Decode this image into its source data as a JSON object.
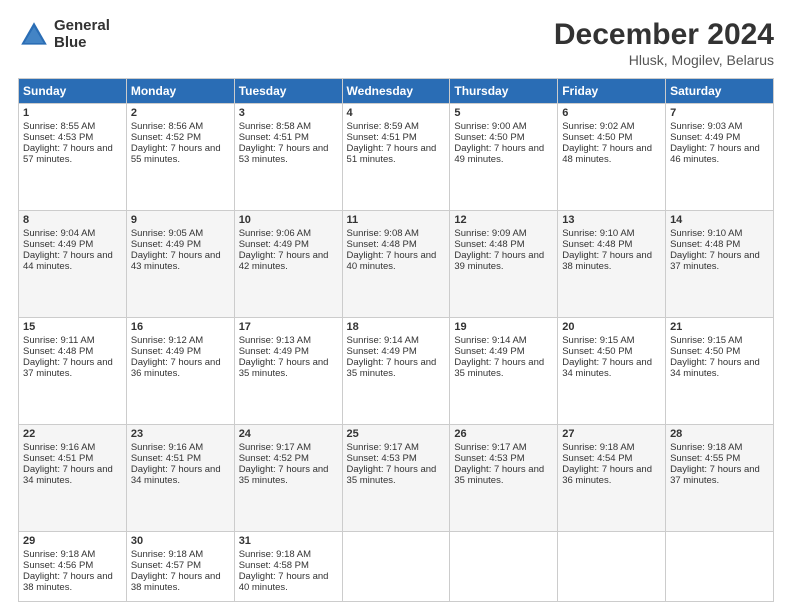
{
  "header": {
    "logo_line1": "General",
    "logo_line2": "Blue",
    "title": "December 2024",
    "subtitle": "Hlusk, Mogilev, Belarus"
  },
  "columns": [
    "Sunday",
    "Monday",
    "Tuesday",
    "Wednesday",
    "Thursday",
    "Friday",
    "Saturday"
  ],
  "weeks": [
    [
      {
        "day": "1",
        "sunrise": "Sunrise: 8:55 AM",
        "sunset": "Sunset: 4:53 PM",
        "daylight": "Daylight: 7 hours and 57 minutes."
      },
      {
        "day": "2",
        "sunrise": "Sunrise: 8:56 AM",
        "sunset": "Sunset: 4:52 PM",
        "daylight": "Daylight: 7 hours and 55 minutes."
      },
      {
        "day": "3",
        "sunrise": "Sunrise: 8:58 AM",
        "sunset": "Sunset: 4:51 PM",
        "daylight": "Daylight: 7 hours and 53 minutes."
      },
      {
        "day": "4",
        "sunrise": "Sunrise: 8:59 AM",
        "sunset": "Sunset: 4:51 PM",
        "daylight": "Daylight: 7 hours and 51 minutes."
      },
      {
        "day": "5",
        "sunrise": "Sunrise: 9:00 AM",
        "sunset": "Sunset: 4:50 PM",
        "daylight": "Daylight: 7 hours and 49 minutes."
      },
      {
        "day": "6",
        "sunrise": "Sunrise: 9:02 AM",
        "sunset": "Sunset: 4:50 PM",
        "daylight": "Daylight: 7 hours and 48 minutes."
      },
      {
        "day": "7",
        "sunrise": "Sunrise: 9:03 AM",
        "sunset": "Sunset: 4:49 PM",
        "daylight": "Daylight: 7 hours and 46 minutes."
      }
    ],
    [
      {
        "day": "8",
        "sunrise": "Sunrise: 9:04 AM",
        "sunset": "Sunset: 4:49 PM",
        "daylight": "Daylight: 7 hours and 44 minutes."
      },
      {
        "day": "9",
        "sunrise": "Sunrise: 9:05 AM",
        "sunset": "Sunset: 4:49 PM",
        "daylight": "Daylight: 7 hours and 43 minutes."
      },
      {
        "day": "10",
        "sunrise": "Sunrise: 9:06 AM",
        "sunset": "Sunset: 4:49 PM",
        "daylight": "Daylight: 7 hours and 42 minutes."
      },
      {
        "day": "11",
        "sunrise": "Sunrise: 9:08 AM",
        "sunset": "Sunset: 4:48 PM",
        "daylight": "Daylight: 7 hours and 40 minutes."
      },
      {
        "day": "12",
        "sunrise": "Sunrise: 9:09 AM",
        "sunset": "Sunset: 4:48 PM",
        "daylight": "Daylight: 7 hours and 39 minutes."
      },
      {
        "day": "13",
        "sunrise": "Sunrise: 9:10 AM",
        "sunset": "Sunset: 4:48 PM",
        "daylight": "Daylight: 7 hours and 38 minutes."
      },
      {
        "day": "14",
        "sunrise": "Sunrise: 9:10 AM",
        "sunset": "Sunset: 4:48 PM",
        "daylight": "Daylight: 7 hours and 37 minutes."
      }
    ],
    [
      {
        "day": "15",
        "sunrise": "Sunrise: 9:11 AM",
        "sunset": "Sunset: 4:48 PM",
        "daylight": "Daylight: 7 hours and 37 minutes."
      },
      {
        "day": "16",
        "sunrise": "Sunrise: 9:12 AM",
        "sunset": "Sunset: 4:49 PM",
        "daylight": "Daylight: 7 hours and 36 minutes."
      },
      {
        "day": "17",
        "sunrise": "Sunrise: 9:13 AM",
        "sunset": "Sunset: 4:49 PM",
        "daylight": "Daylight: 7 hours and 35 minutes."
      },
      {
        "day": "18",
        "sunrise": "Sunrise: 9:14 AM",
        "sunset": "Sunset: 4:49 PM",
        "daylight": "Daylight: 7 hours and 35 minutes."
      },
      {
        "day": "19",
        "sunrise": "Sunrise: 9:14 AM",
        "sunset": "Sunset: 4:49 PM",
        "daylight": "Daylight: 7 hours and 35 minutes."
      },
      {
        "day": "20",
        "sunrise": "Sunrise: 9:15 AM",
        "sunset": "Sunset: 4:50 PM",
        "daylight": "Daylight: 7 hours and 34 minutes."
      },
      {
        "day": "21",
        "sunrise": "Sunrise: 9:15 AM",
        "sunset": "Sunset: 4:50 PM",
        "daylight": "Daylight: 7 hours and 34 minutes."
      }
    ],
    [
      {
        "day": "22",
        "sunrise": "Sunrise: 9:16 AM",
        "sunset": "Sunset: 4:51 PM",
        "daylight": "Daylight: 7 hours and 34 minutes."
      },
      {
        "day": "23",
        "sunrise": "Sunrise: 9:16 AM",
        "sunset": "Sunset: 4:51 PM",
        "daylight": "Daylight: 7 hours and 34 minutes."
      },
      {
        "day": "24",
        "sunrise": "Sunrise: 9:17 AM",
        "sunset": "Sunset: 4:52 PM",
        "daylight": "Daylight: 7 hours and 35 minutes."
      },
      {
        "day": "25",
        "sunrise": "Sunrise: 9:17 AM",
        "sunset": "Sunset: 4:53 PM",
        "daylight": "Daylight: 7 hours and 35 minutes."
      },
      {
        "day": "26",
        "sunrise": "Sunrise: 9:17 AM",
        "sunset": "Sunset: 4:53 PM",
        "daylight": "Daylight: 7 hours and 35 minutes."
      },
      {
        "day": "27",
        "sunrise": "Sunrise: 9:18 AM",
        "sunset": "Sunset: 4:54 PM",
        "daylight": "Daylight: 7 hours and 36 minutes."
      },
      {
        "day": "28",
        "sunrise": "Sunrise: 9:18 AM",
        "sunset": "Sunset: 4:55 PM",
        "daylight": "Daylight: 7 hours and 37 minutes."
      }
    ],
    [
      {
        "day": "29",
        "sunrise": "Sunrise: 9:18 AM",
        "sunset": "Sunset: 4:56 PM",
        "daylight": "Daylight: 7 hours and 38 minutes."
      },
      {
        "day": "30",
        "sunrise": "Sunrise: 9:18 AM",
        "sunset": "Sunset: 4:57 PM",
        "daylight": "Daylight: 7 hours and 38 minutes."
      },
      {
        "day": "31",
        "sunrise": "Sunrise: 9:18 AM",
        "sunset": "Sunset: 4:58 PM",
        "daylight": "Daylight: 7 hours and 40 minutes."
      },
      null,
      null,
      null,
      null
    ]
  ]
}
